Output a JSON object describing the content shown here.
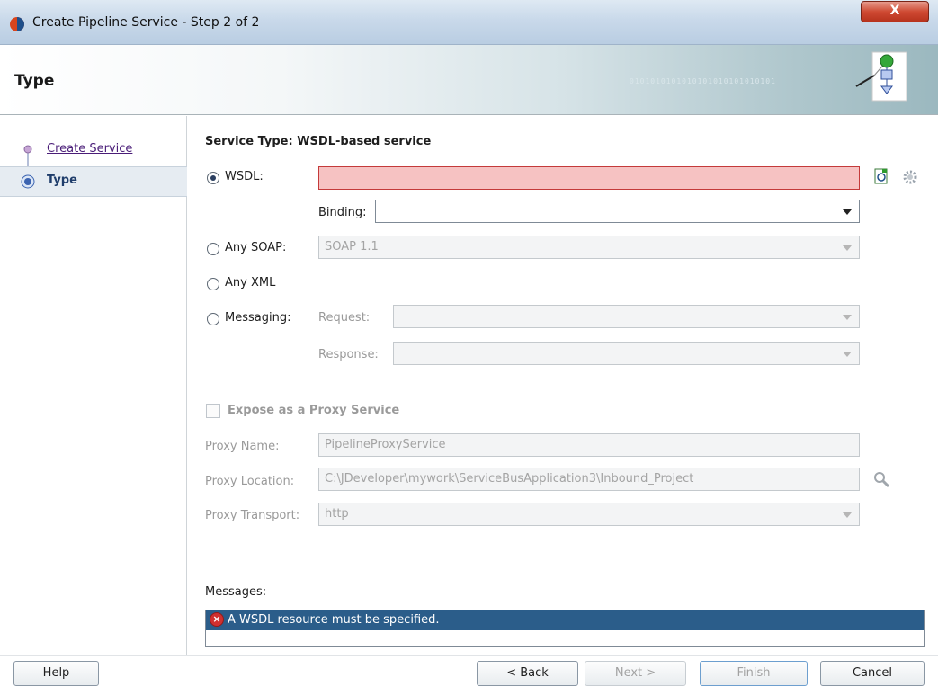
{
  "window": {
    "title": "Create Pipeline Service - Step 2 of 2",
    "close_label": "X"
  },
  "header": {
    "title": "Type",
    "decor_binary": "0101010101010101010101010101"
  },
  "nav": {
    "items": [
      {
        "label": "Create Service"
      },
      {
        "label": "Type"
      }
    ]
  },
  "main": {
    "section_title": "Service Type: WSDL-based service",
    "wsdl": {
      "label": "WSDL:",
      "value": "",
      "selected": true
    },
    "binding": {
      "label": "Binding:",
      "value": ""
    },
    "any_soap": {
      "label": "Any SOAP:",
      "value": "SOAP 1.1"
    },
    "any_xml": {
      "label": "Any XML"
    },
    "messaging": {
      "label": "Messaging:",
      "request_label": "Request:",
      "response_label": "Response:",
      "request_value": "",
      "response_value": ""
    },
    "expose": {
      "label": "Expose as a Proxy Service",
      "checked": false
    },
    "proxy_name": {
      "label": "Proxy Name:",
      "value": "PipelineProxyService"
    },
    "proxy_location": {
      "label": "Proxy Location:",
      "value": "C:\\JDeveloper\\mywork\\ServiceBusApplication3\\Inbound_Project"
    },
    "proxy_transport": {
      "label": "Proxy Transport:",
      "value": "http"
    },
    "messages": {
      "label": "Messages:",
      "items": [
        {
          "text": "A WSDL resource must be specified.",
          "type": "error"
        }
      ]
    }
  },
  "buttons": {
    "help": "Help",
    "back": "< Back",
    "next": "Next >",
    "finish": "Finish",
    "cancel": "Cancel"
  }
}
